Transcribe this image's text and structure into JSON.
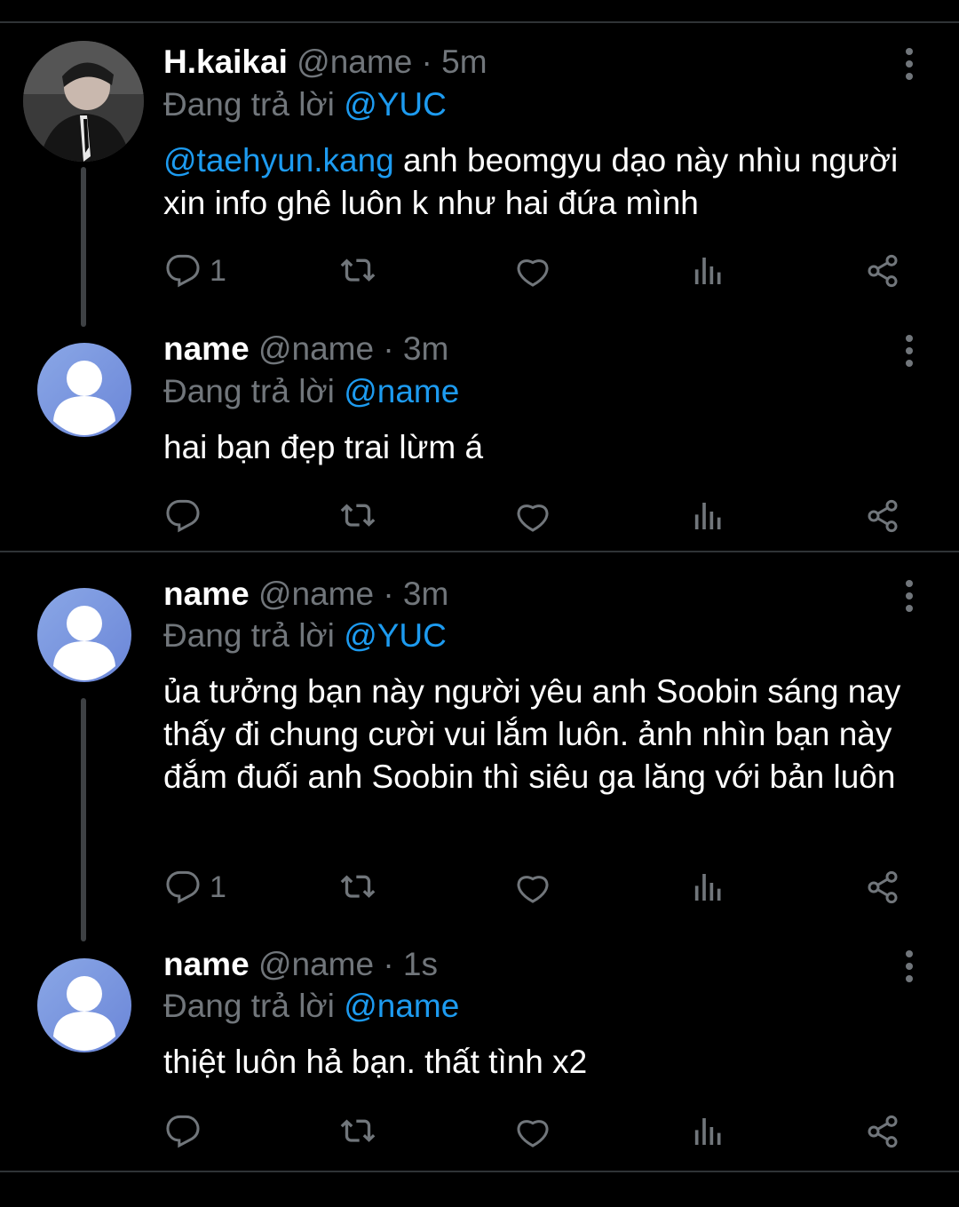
{
  "tweets": [
    {
      "name": "H.kaikai",
      "meta": "@name · 5m",
      "reply_prefix": "Đang trả lời",
      "reply_to": "@YUC",
      "body_mention": "@taehyun.kang",
      "body": " anh beomgyu dạo này nhìu người xin info ghê luôn k như hai đứa mình",
      "reply_count": "1",
      "avatar": "photo-avatar"
    },
    {
      "name": "name",
      "meta": "@name · 3m",
      "reply_prefix": "Đang trả lời",
      "reply_to": "@name",
      "body": "hai bạn đẹp trai lừm á",
      "reply_count": "",
      "avatar": "default-avatar"
    },
    {
      "name": "name",
      "meta": "@name · 3m",
      "reply_prefix": "Đang trả lời",
      "reply_to": "@YUC",
      "body": "ủa tưởng bạn này người yêu anh Soobin sáng nay thấy đi chung cười vui lắm luôn. ảnh nhìn bạn này đắm đuối anh Soobin thì siêu ga lăng với bản luôn",
      "reply_count": "1",
      "avatar": "default-avatar"
    },
    {
      "name": "name",
      "meta": "@name · 1s",
      "reply_prefix": "Đang trả lời",
      "reply_to": "@name",
      "body": "thiệt luôn hả bạn. thất tình x2",
      "reply_count": "",
      "avatar": "default-avatar"
    }
  ],
  "icons": {
    "reply": "comment-icon",
    "retweet": "retweet-icon",
    "like": "heart-icon",
    "views": "analytics-icon",
    "share": "share-icon",
    "more": "more-vertical-icon"
  },
  "colors": {
    "background": "#000000",
    "mention": "#1d9bf0",
    "muted": "#71767b",
    "divider": "#2f3336"
  }
}
